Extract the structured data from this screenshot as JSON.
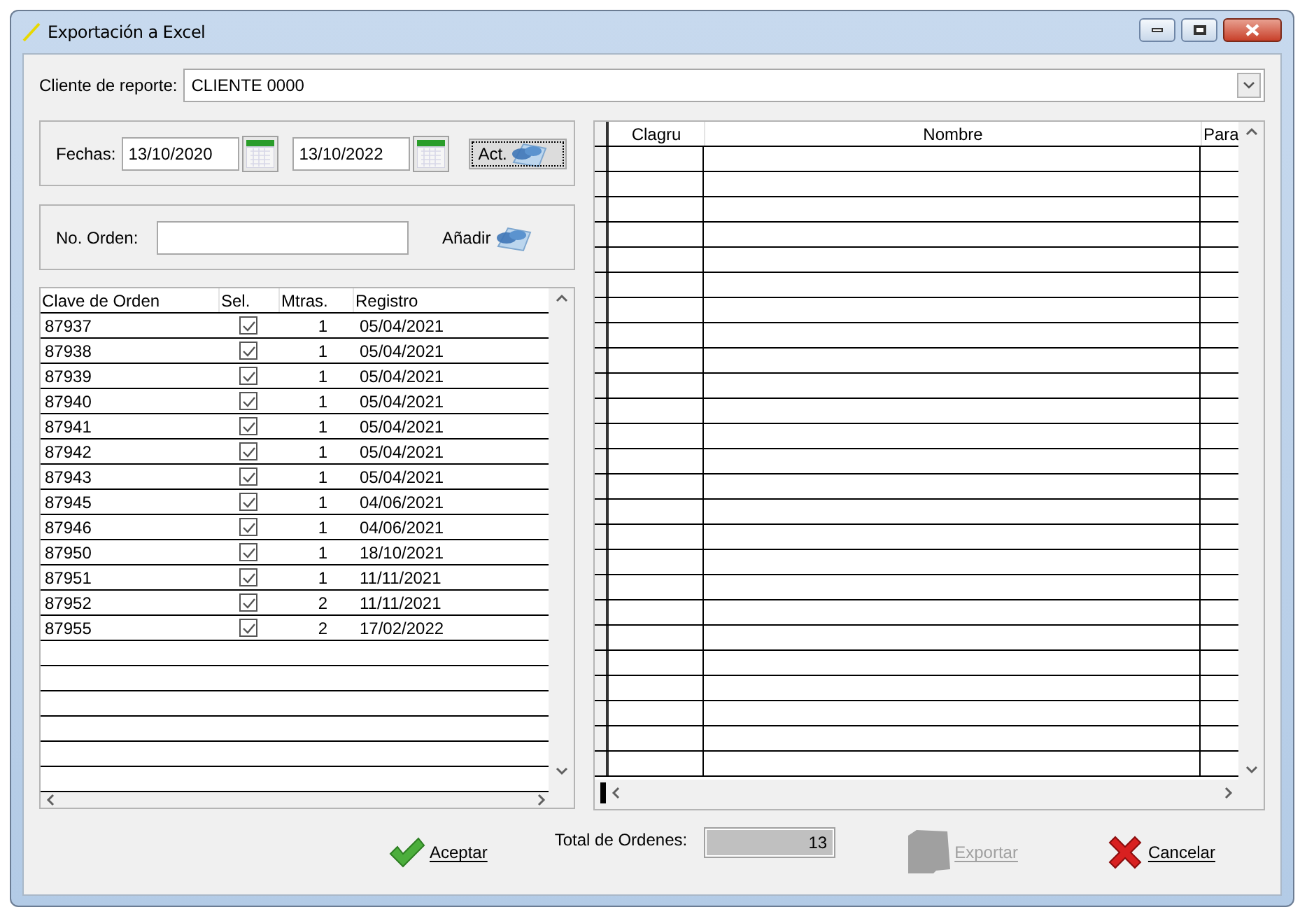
{
  "window": {
    "title": "Exportación a Excel"
  },
  "client": {
    "label": "Cliente de reporte:",
    "value": "CLIENTE 0000"
  },
  "dates": {
    "label": "Fechas:",
    "from": "13/10/2020",
    "to": "13/10/2022",
    "refresh_button": "Act."
  },
  "order_entry": {
    "label": "No. Orden:",
    "add_button": "Añadir"
  },
  "orders_table": {
    "columns": [
      "Clave de Orden",
      "Sel.",
      "Mtras.",
      "Registro"
    ],
    "rows": [
      {
        "clave": "87937",
        "checked": true,
        "mtras": "1",
        "registro": "05/04/2021"
      },
      {
        "clave": "87938",
        "checked": true,
        "mtras": "1",
        "registro": "05/04/2021"
      },
      {
        "clave": "87939",
        "checked": true,
        "mtras": "1",
        "registro": "05/04/2021"
      },
      {
        "clave": "87940",
        "checked": true,
        "mtras": "1",
        "registro": "05/04/2021"
      },
      {
        "clave": "87941",
        "checked": true,
        "mtras": "1",
        "registro": "05/04/2021"
      },
      {
        "clave": "87942",
        "checked": true,
        "mtras": "1",
        "registro": "05/04/2021"
      },
      {
        "clave": "87943",
        "checked": true,
        "mtras": "1",
        "registro": "05/04/2021"
      },
      {
        "clave": "87945",
        "checked": true,
        "mtras": "1",
        "registro": "04/06/2021"
      },
      {
        "clave": "87946",
        "checked": true,
        "mtras": "1",
        "registro": "04/06/2021"
      },
      {
        "clave": "87950",
        "checked": true,
        "mtras": "1",
        "registro": "18/10/2021"
      },
      {
        "clave": "87951",
        "checked": true,
        "mtras": "1",
        "registro": "11/11/2021"
      },
      {
        "clave": "87952",
        "checked": true,
        "mtras": "2",
        "registro": "11/11/2021"
      },
      {
        "clave": "87955",
        "checked": true,
        "mtras": "2",
        "registro": "17/02/2022"
      }
    ]
  },
  "groups_table": {
    "columns": [
      "Clagru",
      "Nombre",
      "Para"
    ]
  },
  "total": {
    "label": "Total de Ordenes:",
    "value": "13"
  },
  "buttons": [
    {
      "kind": "accept",
      "label": "Aceptar",
      "disabled": false
    },
    {
      "kind": "export",
      "label": "Exportar",
      "disabled": true
    },
    {
      "kind": "cancel",
      "label": "Cancelar",
      "disabled": false
    }
  ]
}
